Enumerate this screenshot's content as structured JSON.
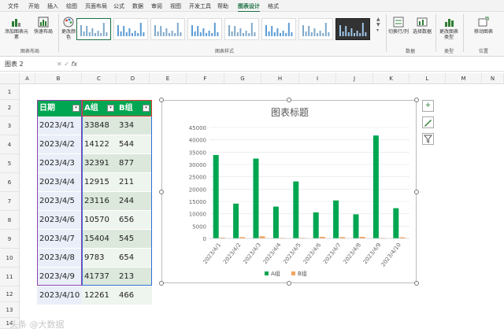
{
  "menu": {
    "items": [
      "文件",
      "开始",
      "插入",
      "绘图",
      "页面布局",
      "公式",
      "数据",
      "审阅",
      "视图",
      "开发工具",
      "帮助",
      "图表设计",
      "格式"
    ],
    "active_index": 11
  },
  "ribbon": {
    "add_element": "添加图表元素",
    "quick_layout": "快速布局",
    "change_colors": "更改颜色",
    "group_layout": "图表布局",
    "group_styles": "图表样式",
    "switch_row_col": "切换行/列",
    "select_data": "选择数据",
    "group_data": "数据",
    "change_type": "更改图表类型",
    "group_type": "类型",
    "move_chart": "移动图表",
    "group_location": "位置"
  },
  "formula_bar": {
    "name_box": "图表 2",
    "fx": "fx"
  },
  "columns": [
    "A",
    "B",
    "C",
    "D",
    "E",
    "F",
    "G",
    "H",
    "I",
    "J",
    "K",
    "L",
    "M",
    "N"
  ],
  "rows": [
    "1",
    "2",
    "3",
    "4",
    "5",
    "6",
    "7",
    "8",
    "9",
    "10",
    "11",
    "12",
    "13",
    "14"
  ],
  "table": {
    "headers": [
      "日期",
      "A组",
      "B组"
    ],
    "rows": [
      [
        "2023/4/1",
        "33848",
        "334"
      ],
      [
        "2023/4/2",
        "14122",
        "544"
      ],
      [
        "2023/4/3",
        "32391",
        "877"
      ],
      [
        "2023/4/4",
        "12915",
        "211"
      ],
      [
        "2023/4/5",
        "23116",
        "244"
      ],
      [
        "2023/4/6",
        "10570",
        "656"
      ],
      [
        "2023/4/7",
        "15404",
        "545"
      ],
      [
        "2023/4/8",
        "9783",
        "654"
      ],
      [
        "2023/4/9",
        "41737",
        "213"
      ],
      [
        "2023/4/10",
        "12261",
        "466"
      ]
    ]
  },
  "chart_data": {
    "type": "bar",
    "title": "图表标题",
    "categories": [
      "2023/4/1",
      "2023/4/2",
      "2023/4/3",
      "2023/4/4",
      "2023/4/5",
      "2023/4/6",
      "2023/4/7",
      "2023/4/8",
      "2023/4/9",
      "2023/4/10"
    ],
    "series": [
      {
        "name": "A组",
        "values": [
          33848,
          14122,
          32391,
          12915,
          23116,
          10570,
          15404,
          9783,
          41737,
          12261
        ],
        "color": "#00a651"
      },
      {
        "name": "B组",
        "values": [
          334,
          544,
          877,
          211,
          244,
          656,
          545,
          654,
          213,
          466
        ],
        "color": "#f4a460"
      }
    ],
    "yticks": [
      "0",
      "5000",
      "10000",
      "15000",
      "20000",
      "25000",
      "30000",
      "35000",
      "40000",
      "45000"
    ],
    "ylim": [
      0,
      45000
    ],
    "grid": true,
    "legend": "bottom"
  },
  "side_buttons": [
    "chart-elements-icon",
    "chart-styles-icon",
    "chart-filters-icon"
  ],
  "watermark": "头条 @大数据"
}
